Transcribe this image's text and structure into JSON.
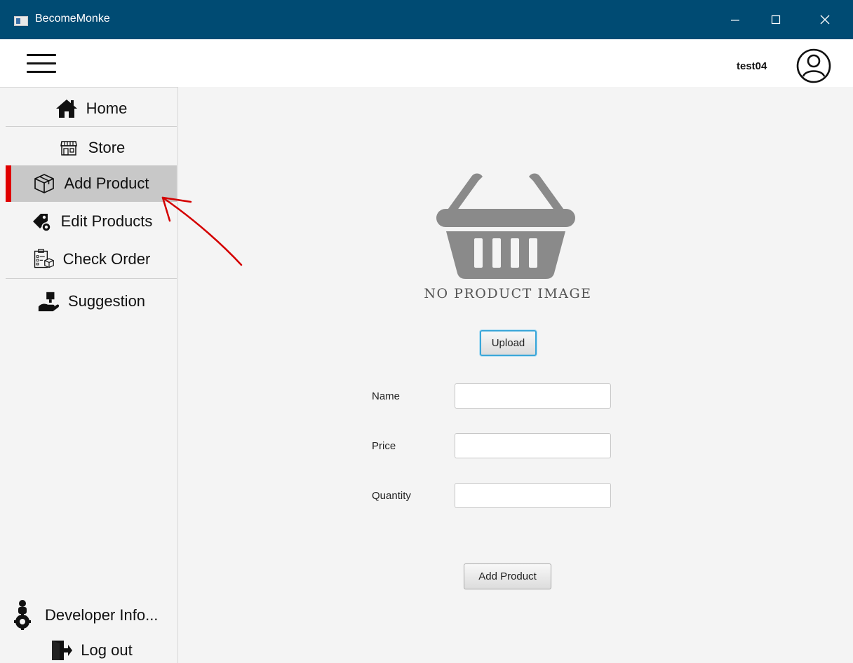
{
  "window": {
    "title": "BecomeMonke"
  },
  "header": {
    "username": "test04"
  },
  "sidebar": {
    "items": [
      {
        "label": "Home",
        "icon": "home-icon"
      },
      {
        "label": "Store",
        "icon": "store-icon"
      },
      {
        "label": "Add Product",
        "icon": "box-icon",
        "active": true
      },
      {
        "label": "Edit Products",
        "icon": "tag-gear-icon"
      },
      {
        "label": "Check Order",
        "icon": "clipboard-icon"
      },
      {
        "label": "Suggestion",
        "icon": "hand-icon"
      }
    ],
    "bottom": [
      {
        "label": "Developer Info...",
        "icon": "developer-icon"
      },
      {
        "label": "Log out",
        "icon": "logout-icon"
      }
    ]
  },
  "product_form": {
    "image_placeholder": "NO PRODUCT IMAGE",
    "upload_label": "Upload",
    "fields": [
      {
        "label": "Name",
        "value": ""
      },
      {
        "label": "Price",
        "value": ""
      },
      {
        "label": "Quantity",
        "value": ""
      }
    ],
    "submit_label": "Add Product"
  },
  "colors": {
    "titlebar": "#004b73",
    "active_indicator": "#e00000",
    "annotation": "#d40000"
  }
}
